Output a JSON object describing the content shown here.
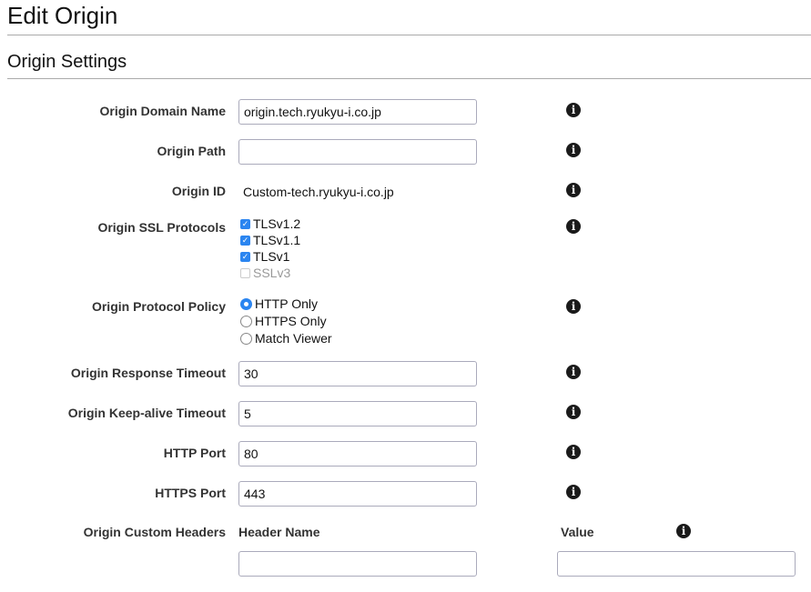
{
  "page": {
    "title": "Edit Origin",
    "section_title": "Origin Settings"
  },
  "fields": {
    "origin_domain_name": {
      "label": "Origin Domain Name",
      "value": "origin.tech.ryukyu-i.co.jp"
    },
    "origin_path": {
      "label": "Origin Path",
      "value": ""
    },
    "origin_id": {
      "label": "Origin ID",
      "value": "Custom-tech.ryukyu-i.co.jp"
    },
    "origin_ssl_protocols": {
      "label": "Origin SSL Protocols",
      "options": [
        {
          "label": "TLSv1.2",
          "checked": true,
          "disabled": false
        },
        {
          "label": "TLSv1.1",
          "checked": true,
          "disabled": false
        },
        {
          "label": "TLSv1",
          "checked": true,
          "disabled": false
        },
        {
          "label": "SSLv3",
          "checked": false,
          "disabled": true
        }
      ]
    },
    "origin_protocol_policy": {
      "label": "Origin Protocol Policy",
      "options": [
        {
          "label": "HTTP Only",
          "selected": true
        },
        {
          "label": "HTTPS Only",
          "selected": false
        },
        {
          "label": "Match Viewer",
          "selected": false
        }
      ]
    },
    "origin_response_timeout": {
      "label": "Origin Response Timeout",
      "value": "30"
    },
    "origin_keepalive_timeout": {
      "label": "Origin Keep-alive Timeout",
      "value": "5"
    },
    "http_port": {
      "label": "HTTP Port",
      "value": "80"
    },
    "https_port": {
      "label": "HTTPS Port",
      "value": "443"
    },
    "origin_custom_headers": {
      "label": "Origin Custom Headers",
      "header_name_label": "Header Name",
      "value_label": "Value",
      "header_name_value": "",
      "value_value": ""
    }
  },
  "icons": {
    "info": "info-icon",
    "info_glyph": "i"
  },
  "colors": {
    "accent": "#2b85f0",
    "divider": "#aaaaaa"
  }
}
